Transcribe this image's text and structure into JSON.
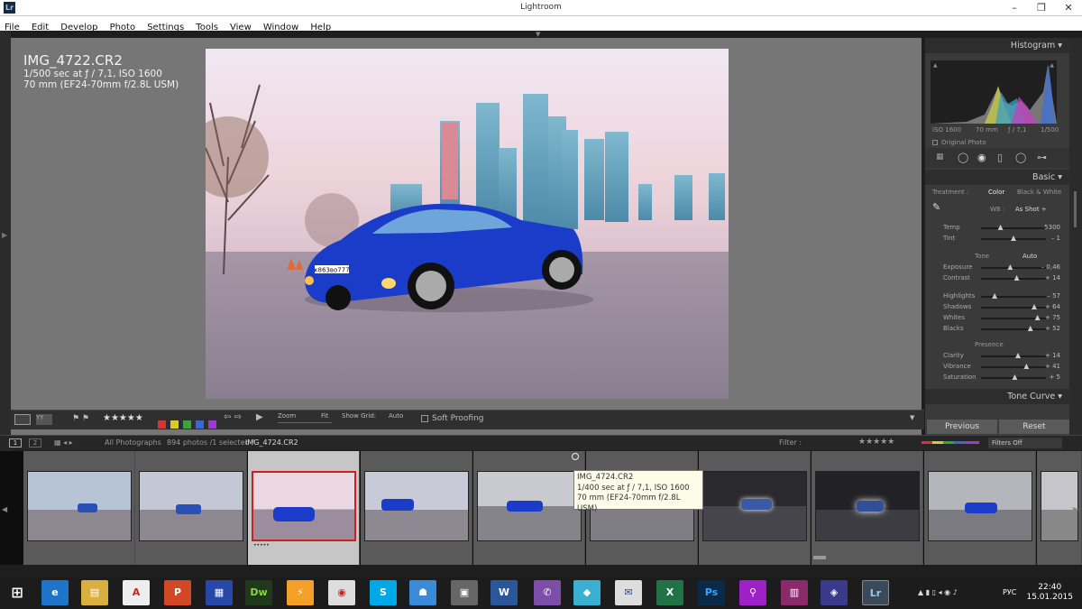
{
  "window": {
    "title": "Lightroom",
    "logo": "Lr",
    "minimize": "–",
    "maximize": "❐",
    "close": "✕"
  },
  "menu": [
    "File",
    "Edit",
    "Develop",
    "Photo",
    "Settings",
    "Tools",
    "View",
    "Window",
    "Help"
  ],
  "photo_info": {
    "filename": "IMG_4722.CR2",
    "exposure": "1/500 sec at ƒ / 7,1, ISO 1600",
    "lens": "70 mm (EF24-70mm f/2.8L USM)",
    "plate": "к863во777"
  },
  "histogram": {
    "title": "Histogram",
    "iso": "ISO 1600",
    "focal": "70 mm",
    "aperture": "ƒ / 7,1",
    "shutter": "1/500",
    "original_photo": "Original Photo"
  },
  "basic": {
    "title": "Basic",
    "treatment_label": "Treatment :",
    "treatment_color": "Color",
    "treatment_bw": "Black & White",
    "wb_label": "WB :",
    "wb_value": "As Shot ÷",
    "tone_label": "Tone",
    "auto": "Auto",
    "presence_label": "Presence",
    "sliders": [
      {
        "name": "Temp",
        "value": "5300",
        "pos": 0.3
      },
      {
        "name": "Tint",
        "value": "– 1",
        "pos": 0.5
      },
      {
        "name": "Exposure",
        "value": "– 0,46",
        "pos": 0.45
      },
      {
        "name": "Contrast",
        "value": "+ 14",
        "pos": 0.55
      },
      {
        "name": "Highlights",
        "value": "– 57",
        "pos": 0.21
      },
      {
        "name": "Shadows",
        "value": "+ 64",
        "pos": 0.82
      },
      {
        "name": "Whites",
        "value": "+ 75",
        "pos": 0.87
      },
      {
        "name": "Blacks",
        "value": "+ 52",
        "pos": 0.76
      },
      {
        "name": "Clarity",
        "value": "+ 14",
        "pos": 0.57
      },
      {
        "name": "Vibrance",
        "value": "+ 41",
        "pos": 0.7
      },
      {
        "name": "Saturation",
        "value": "+ 5",
        "pos": 0.52
      }
    ]
  },
  "tone_curve": "Tone Curve",
  "buttons": {
    "previous": "Previous",
    "reset": "Reset"
  },
  "toolbar": {
    "stars": "★★★★★",
    "zoom": "Zoom",
    "fit": "Fit",
    "show_grid": "Show Grid:",
    "auto": "Auto",
    "soft_proofing": "Soft Proofing"
  },
  "filmstrip_bar": {
    "page1": "1",
    "page2": "2",
    "source": "All Photographs",
    "count": "894 photos /1 selected /",
    "selected_file": "IMG_4724.CR2",
    "filter": "Filter :",
    "filters_off": "Filters Off",
    "stars": "★★★★★"
  },
  "tooltip": {
    "name": "IMG_4724.CR2",
    "exposure": "1/400 sec at ƒ / 7,1, ISO 1600",
    "lens": "70 mm (EF24-70mm f/2.8L USM)"
  },
  "selected_dots": "•••••",
  "taskbar": {
    "time": "22:40",
    "date": "15.01.2015",
    "lang": "РУС"
  },
  "colors": {
    "accent_red": "#c92020",
    "car_blue": "#1a3cc8",
    "panel_bg": "#3a3a3a"
  }
}
